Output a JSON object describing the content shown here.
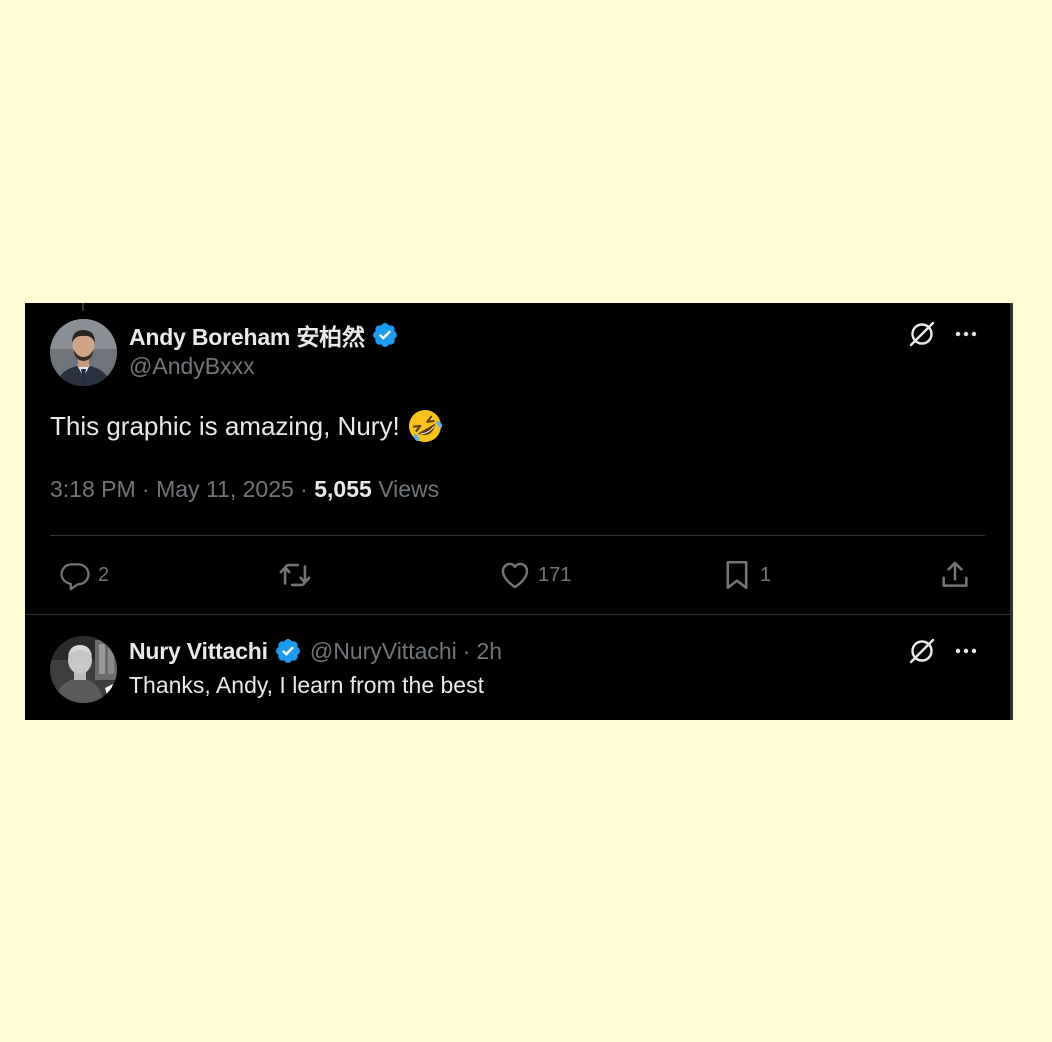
{
  "colors": {
    "page_background": "#fffbd2",
    "card_background": "#000000",
    "primary_text": "#e7e9ea",
    "secondary_text": "#71767b",
    "verified_badge": "#1d9bf0",
    "divider": "#2f3336"
  },
  "main_tweet": {
    "author": {
      "display_name": "Andy Boreham 安柏然",
      "handle": "@AndyBxxx",
      "verified": true,
      "avatar_icon": "avatar-photo-man-beard"
    },
    "text": "This graphic is amazing, Nury!",
    "emoji": "rolling-on-floor-laughing",
    "time": "3:18 PM",
    "date": "May 11, 2025",
    "separator": "·",
    "views_count": "5,055",
    "views_label": "Views",
    "top_icons": [
      "grok-icon",
      "more-icon"
    ],
    "actions": {
      "replies": "2",
      "reposts": "",
      "likes": "171",
      "bookmarks": "1"
    }
  },
  "reply": {
    "author": {
      "display_name": "Nury Vittachi",
      "handle": "@NuryVittachi",
      "verified": true,
      "avatar_icon": "avatar-photo-man-grayscale"
    },
    "separator": "·",
    "time": "2h",
    "text": "Thanks, Andy, I learn from the best",
    "top_icons": [
      "grok-icon",
      "more-icon"
    ]
  }
}
